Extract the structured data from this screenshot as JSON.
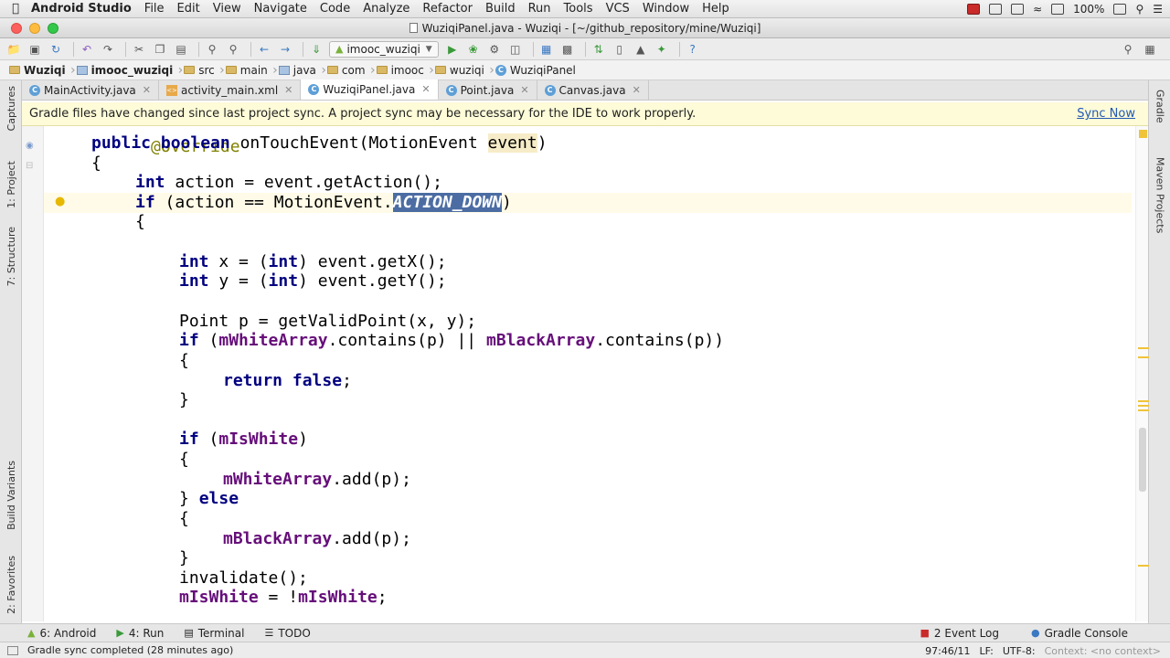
{
  "menubar": {
    "app_name": "Android Studio",
    "items": [
      "File",
      "Edit",
      "View",
      "Navigate",
      "Code",
      "Analyze",
      "Refactor",
      "Build",
      "Run",
      "Tools",
      "VCS",
      "Window",
      "Help"
    ],
    "battery": "100%"
  },
  "window": {
    "title": "WuziqiPanel.java - Wuziqi - [~/github_repository/mine/Wuziqi]"
  },
  "toolbar": {
    "run_config": "imooc_wuziqi"
  },
  "breadcrumb": [
    "Wuziqi",
    "imooc_wuziqi",
    "src",
    "main",
    "java",
    "com",
    "imooc",
    "wuziqi",
    "WuziqiPanel"
  ],
  "tabs": [
    {
      "label": "MainActivity.java"
    },
    {
      "label": "activity_main.xml"
    },
    {
      "label": "WuziqiPanel.java"
    },
    {
      "label": "Point.java"
    },
    {
      "label": "Canvas.java"
    }
  ],
  "left_tools": [
    "Captures",
    "1: Project",
    "7: Structure",
    "Build Variants",
    "2: Favorites"
  ],
  "right_tools": [
    "Gradle",
    "Maven Projects"
  ],
  "banner": {
    "message": "Gradle files have changed since last project sync. A project sync may be necessary for the IDE to work properly.",
    "action": "Sync Now"
  },
  "code": {
    "l0": "@Override",
    "l1_kw1": "public",
    "l1_kw2": "boolean",
    "l1_rest": " onTouchEvent(MotionEvent ",
    "l1_param": "event",
    "l1_end": ")",
    "l2": "{",
    "l3_kw": "int",
    "l3_rest": " action = event.getAction();",
    "l4_kw": "if",
    "l4_rest": " (action == MotionEvent.",
    "l4_sel": "ACTION_DOWN",
    "l4_end": ")",
    "l5": "{",
    "l7_kw": "int",
    "l7_a": " x = (",
    "l7_kw2": "int",
    "l7_b": ") event.getX();",
    "l8_kw": "int",
    "l8_a": " y = (",
    "l8_kw2": "int",
    "l8_b": ") event.getY();",
    "l10": "Point p = getValidPoint(x, y);",
    "l11_kw": "if",
    "l11_a": " (",
    "l11_f1": "mWhiteArray",
    "l11_b": ".contains(p) || ",
    "l11_f2": "mBlackArray",
    "l11_c": ".contains(p))",
    "l12": "{",
    "l13_kw": "return",
    "l13_kw2": "false",
    "l13_end": ";",
    "l14": "}",
    "l16_kw": "if",
    "l16_a": " (",
    "l16_f": "mIsWhite",
    "l16_b": ")",
    "l17": "{",
    "l18_f": "mWhiteArray",
    "l18_rest": ".add(p);",
    "l19_a": "} ",
    "l19_kw": "else",
    "l20": "{",
    "l21_f": "mBlackArray",
    "l21_rest": ".add(p);",
    "l22": "}",
    "l23": "invalidate();",
    "l24_f1": "mIsWhite",
    "l24_a": " = !",
    "l24_f2": "mIsWhite",
    "l24_end": ";"
  },
  "toolwindows": {
    "android": "6: Android",
    "run": "4: Run",
    "terminal": "Terminal",
    "todo": "TODO",
    "event_log": "Event Log",
    "event_log_count": "2",
    "gradle_console": "Gradle Console"
  },
  "status": {
    "message": "Gradle sync completed (28 minutes ago)",
    "position": "97:46/11",
    "line_sep": "LF:",
    "encoding": "UTF-8:",
    "context": "Context: <no context>"
  },
  "icons": {
    "apple": "apple-icon",
    "run": "play-icon",
    "debug": "bug-icon",
    "search": "search-icon"
  }
}
